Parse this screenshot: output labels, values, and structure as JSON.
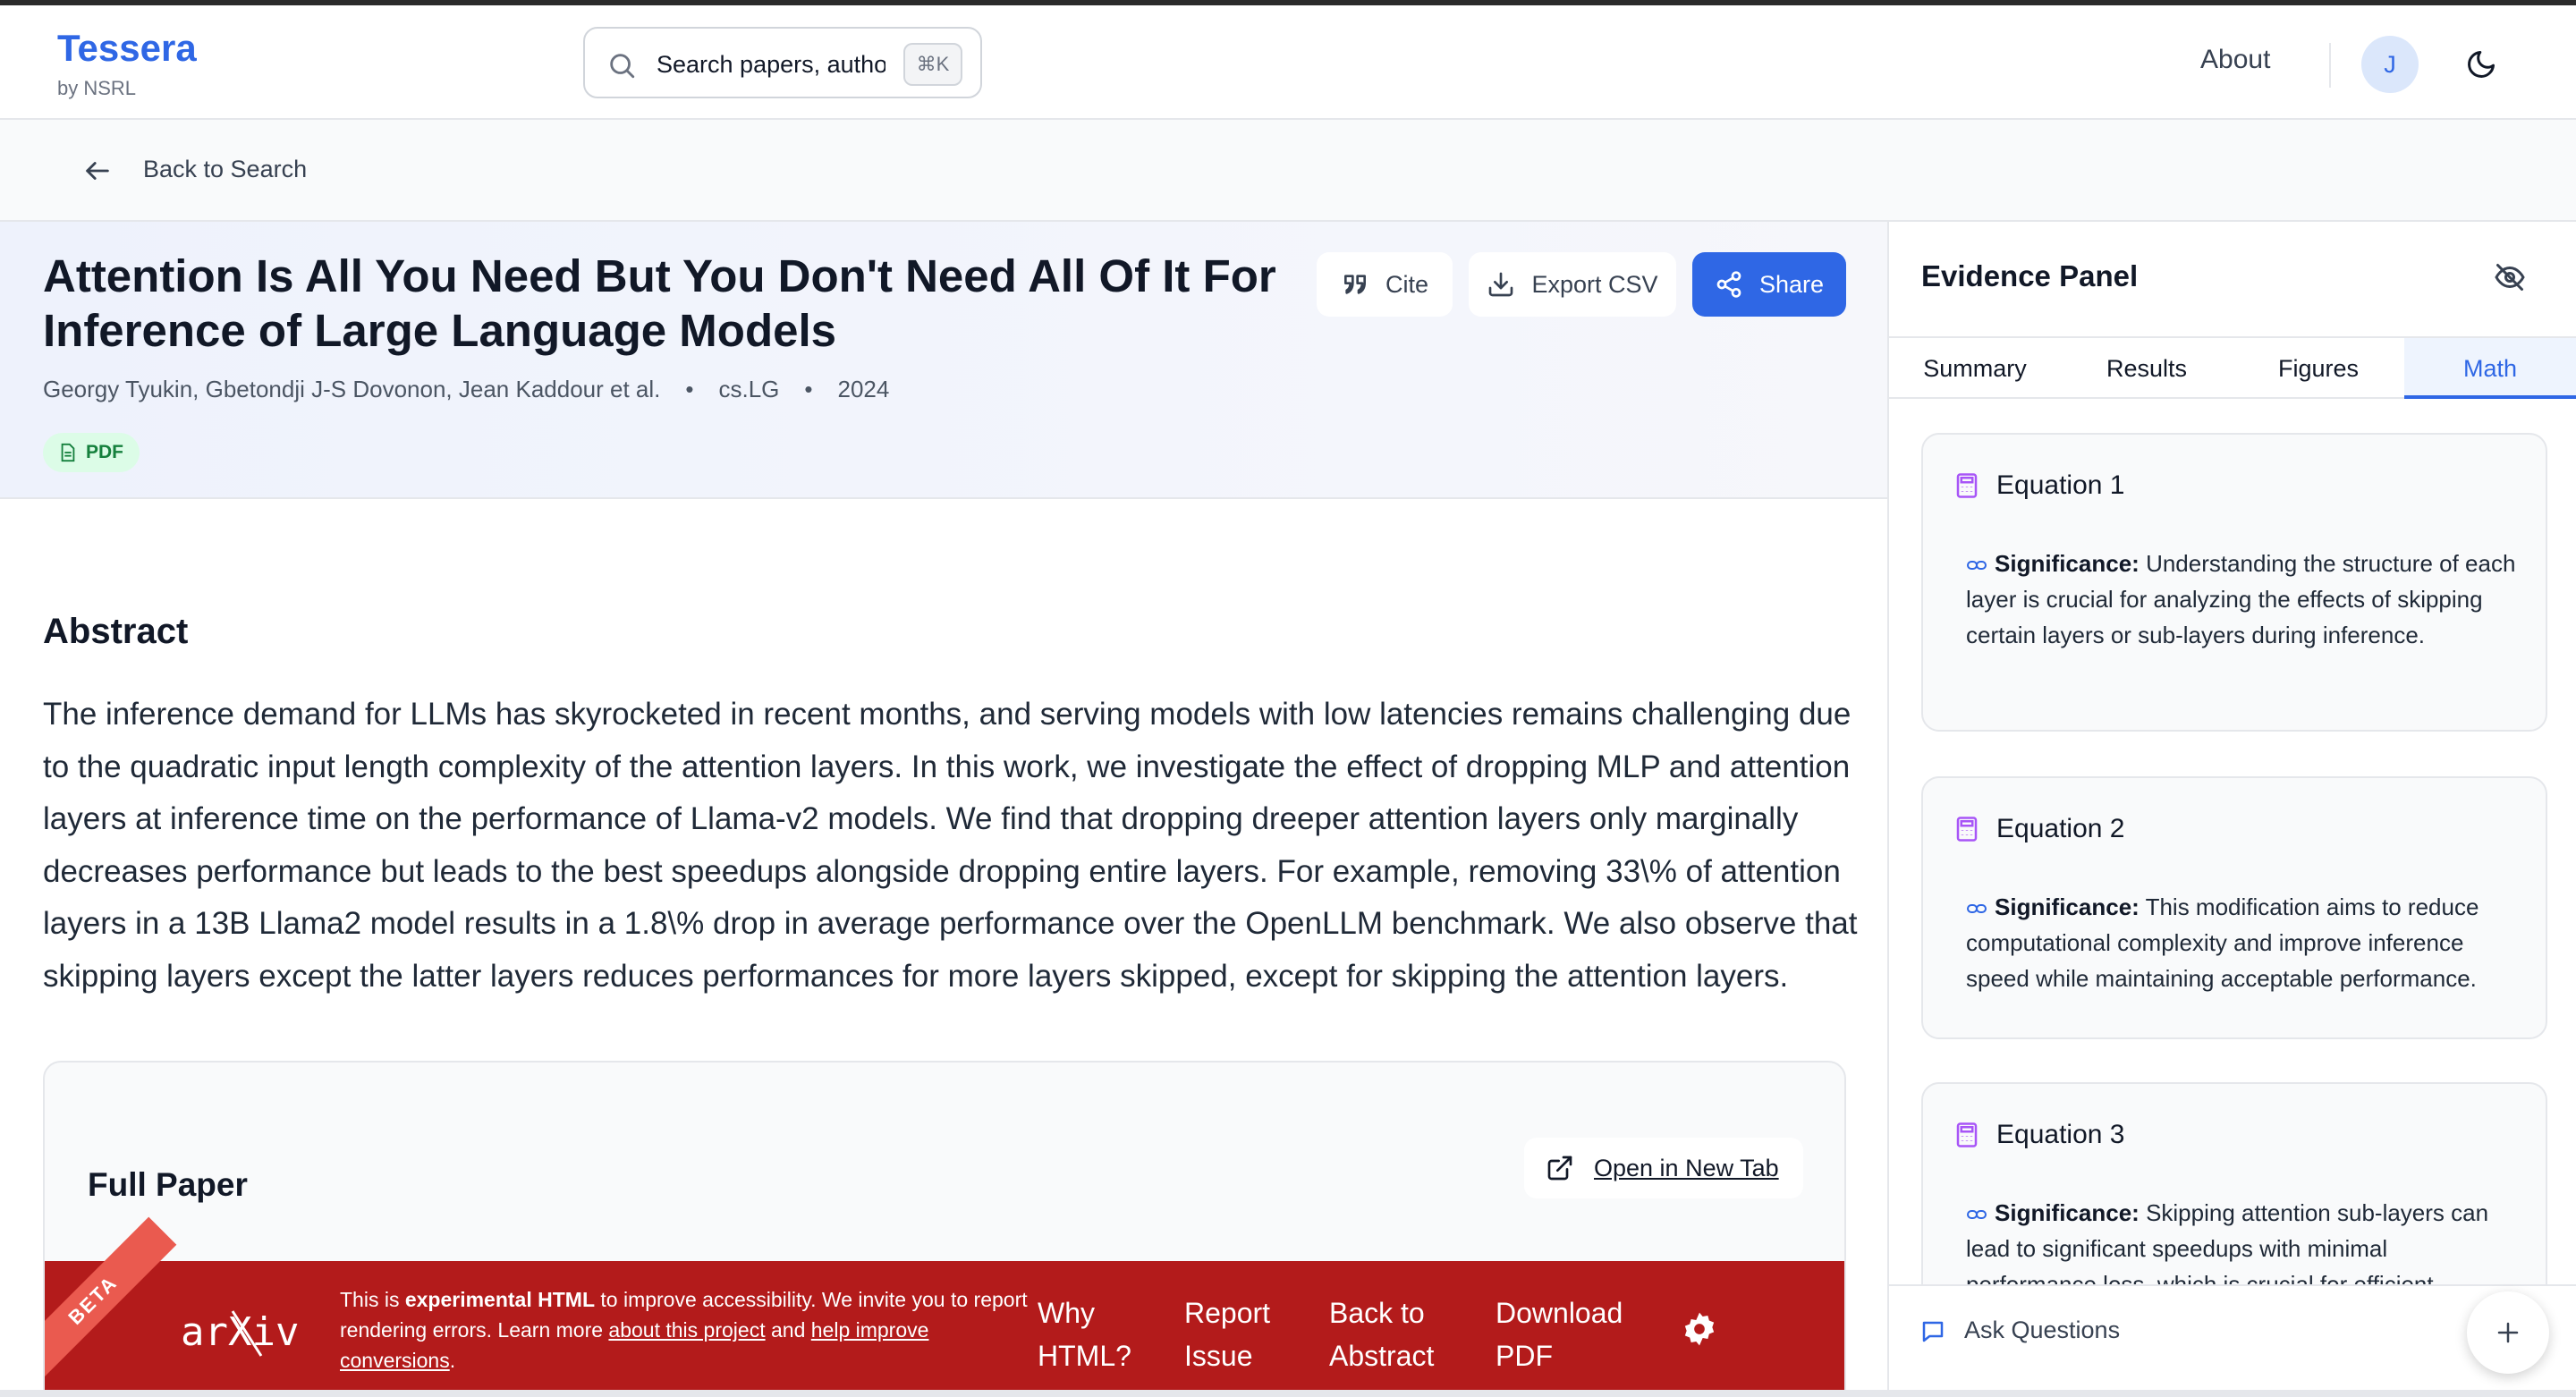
{
  "header": {
    "brand_title": "Tessera",
    "brand_sub": "by NSRL",
    "search_placeholder": "Search papers, authors...",
    "search_shortcut": "⌘K",
    "about_label": "About",
    "avatar_initial": "J"
  },
  "nav": {
    "back_label": "Back to Search"
  },
  "paper": {
    "title": "Attention Is All You Need But You Don't Need All Of It For Inference of Large Language Models",
    "authors": "Georgy Tyukin, Gbetondji J-S Dovonon, Jean Kaddour et al.",
    "category": "cs.LG",
    "year": "2024",
    "badge": "PDF",
    "actions": {
      "cite": "Cite",
      "export": "Export CSV",
      "share": "Share"
    },
    "abstract_heading": "Abstract",
    "abstract": "The inference demand for LLMs has skyrocketed in recent months, and serving models with low latencies remains challenging due to the quadratic input length complexity of the attention layers. In this work, we investigate the effect of dropping MLP and attention layers at inference time on the performance of Llama-v2 models. We find that dropping dreeper attention layers only marginally decreases performance but leads to the best speedups alongside dropping entire layers. For example, removing 33\\% of attention layers in a 13B Llama2 model results in a 1.8\\% drop in average performance over the OpenLLM benchmark. We also observe that skipping layers except the latter layers reduces performances for more layers skipped, except for skipping the attention layers."
  },
  "full_paper": {
    "title": "Full Paper",
    "open_tab": "Open in New Tab",
    "arxiv": {
      "beta": "BETA",
      "logo_text": "arXiv",
      "msg_1": "This is ",
      "msg_bold": "experimental HTML",
      "msg_2": " to improve accessibility. We invite you to report rendering errors. Learn more ",
      "msg_link1": "about this project",
      "msg_3": " and ",
      "msg_link2": "help improve conversions",
      "msg_4": ".",
      "links": [
        "Why HTML?",
        "Report Issue",
        "Back to Abstract",
        "Download PDF"
      ]
    }
  },
  "panel": {
    "title": "Evidence Panel",
    "tabs": [
      "Summary",
      "Results",
      "Figures",
      "Math"
    ],
    "active_tab": "Math",
    "significance_label": "Significance:",
    "equations": [
      {
        "title": "Equation 1",
        "text": "Understanding the structure of each layer is crucial for analyzing the effects of skipping certain layers or sub-layers during inference."
      },
      {
        "title": "Equation 2",
        "text": "This modification aims to reduce computational complexity and improve inference speed while maintaining acceptable performance."
      },
      {
        "title": "Equation 3",
        "text": "Skipping attention sub-layers can lead to significant speedups with minimal performance loss, which is crucial for efficient"
      }
    ],
    "ask_label": "Ask Questions"
  },
  "colors": {
    "accent": "#2f67e5",
    "arxiv_red": "#b31b1b",
    "badge_green": "#15803d"
  }
}
